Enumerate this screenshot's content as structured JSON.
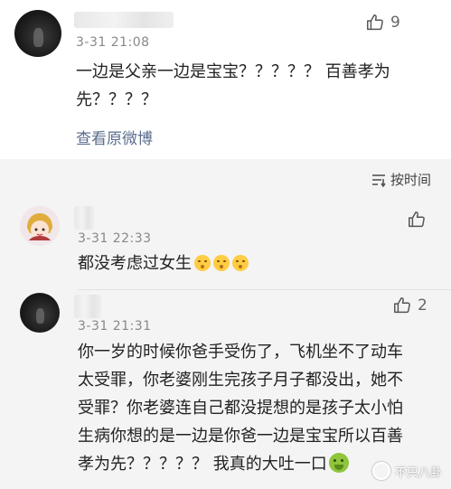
{
  "main_comment": {
    "time": "3-31 21:08",
    "text_line1": "一边是父亲一边是宝宝？？？？？ 百善孝为",
    "text_line2": "先？？？？",
    "view_original": "查看原微博",
    "likes": "9"
  },
  "sort": {
    "label": "按时间"
  },
  "replies": [
    {
      "time": "3-31 22:33",
      "text": "都没考虑过女生",
      "emoji_count": 3,
      "likes": ""
    },
    {
      "time": "3-31 21:31",
      "lines": [
        "你一岁的时候你爸手受伤了，飞机坐不了动车",
        "太受罪，你老婆刚生完孩子月子都没出，她不",
        "受罪？你老婆连自己都没提想的是孩子太小怕",
        "生病你想的是一边是你爸一边是宝宝所以百善",
        "孝为先？？？？？ 我真的大吐一口"
      ],
      "likes": "2"
    }
  ],
  "watermark": {
    "text": "不只八卦"
  }
}
